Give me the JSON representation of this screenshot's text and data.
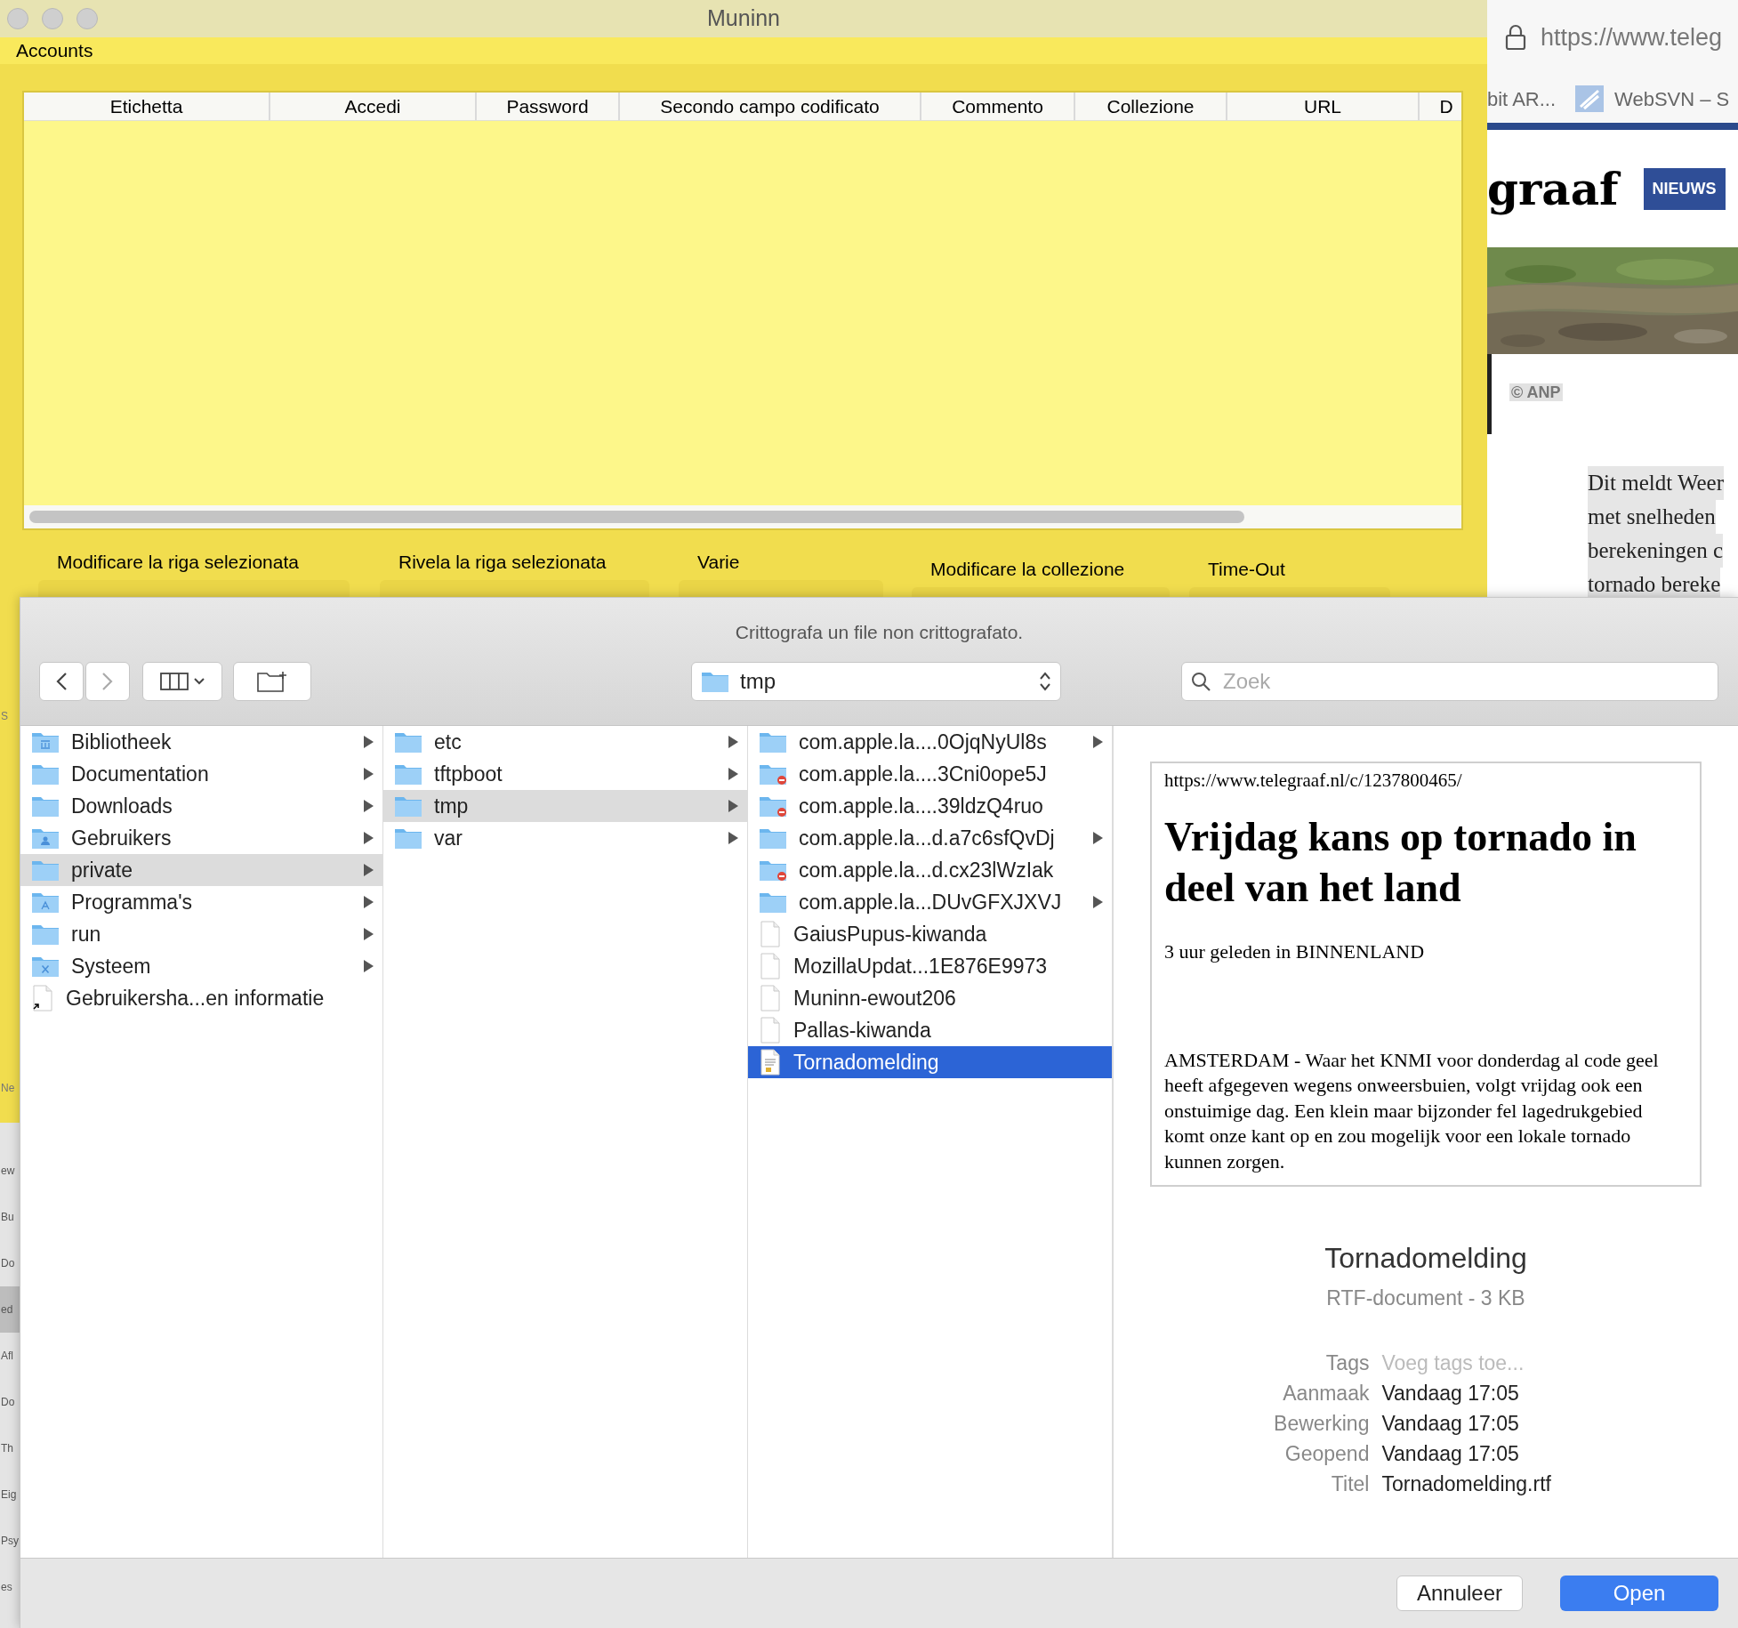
{
  "muninn": {
    "title": "Muninn",
    "menu": "Accounts",
    "table": {
      "columns": [
        "Etichetta",
        "Accedi",
        "Password",
        "Secondo campo codificato",
        "Commento",
        "Collezione",
        "URL",
        "D"
      ]
    },
    "buttons": [
      "Modificare la riga selezionata",
      "Rivela la riga selezionata",
      "Varie",
      "Modificare la collezione",
      "Time-Out"
    ],
    "edge_fragments": [
      "S",
      "Ne"
    ]
  },
  "finder_strip": {
    "items": [
      {
        "label": "ew",
        "selected": false
      },
      {
        "label": "Bu",
        "selected": false
      },
      {
        "label": "Do",
        "selected": false
      },
      {
        "label": "ed",
        "selected": true
      },
      {
        "label": "Afl",
        "selected": false
      },
      {
        "label": "Do",
        "selected": false
      },
      {
        "label": "Th",
        "selected": false
      },
      {
        "label": "Eig",
        "selected": false
      },
      {
        "label": "Psy",
        "selected": false
      },
      {
        "label": "es",
        "selected": false
      }
    ]
  },
  "browser": {
    "address": "https://www.teleg",
    "bookmarks": [
      {
        "label": "bit AR...",
        "icon": false
      },
      {
        "label": "WebSVN – S",
        "icon": true
      }
    ],
    "logo": "graaf",
    "section_badge": "NIEUWS",
    "credit": "© ANP",
    "article_lines": [
      "Dit meldt Weer",
      "met snelheden",
      "berekeningen c",
      "tornado bereke"
    ]
  },
  "dialog": {
    "title": "Crittografa un file non crittografato.",
    "toolbar": {
      "path": "tmp",
      "search_placeholder": "Zoek"
    },
    "columns": [
      {
        "focused": false,
        "items": [
          {
            "name": "Bibliotheek",
            "kind": "library",
            "has_children": true,
            "restricted": false,
            "selected": false
          },
          {
            "name": "Documentation",
            "kind": "folder",
            "has_children": true,
            "restricted": false,
            "selected": false
          },
          {
            "name": "Downloads",
            "kind": "folder",
            "has_children": true,
            "restricted": false,
            "selected": false
          },
          {
            "name": "Gebruikers",
            "kind": "users",
            "has_children": true,
            "restricted": false,
            "selected": false
          },
          {
            "name": "private",
            "kind": "folder",
            "has_children": true,
            "restricted": false,
            "selected": true
          },
          {
            "name": "Programma's",
            "kind": "apps",
            "has_children": true,
            "restricted": false,
            "selected": false
          },
          {
            "name": "run",
            "kind": "folder",
            "has_children": true,
            "restricted": false,
            "selected": false
          },
          {
            "name": "Systeem",
            "kind": "system",
            "has_children": true,
            "restricted": false,
            "selected": false
          },
          {
            "name": "Gebruikersha...en informatie",
            "kind": "alias",
            "has_children": false,
            "restricted": false,
            "selected": false
          }
        ]
      },
      {
        "focused": false,
        "items": [
          {
            "name": "etc",
            "kind": "folder",
            "has_children": true,
            "restricted": false,
            "selected": false
          },
          {
            "name": "tftpboot",
            "kind": "folder",
            "has_children": true,
            "restricted": false,
            "selected": false
          },
          {
            "name": "tmp",
            "kind": "folder",
            "has_children": true,
            "restricted": false,
            "selected": true
          },
          {
            "name": "var",
            "kind": "folder",
            "has_children": true,
            "restricted": false,
            "selected": false
          }
        ]
      },
      {
        "focused": true,
        "items": [
          {
            "name": "com.apple.la....0OjqNyUl8s",
            "kind": "folder",
            "has_children": true,
            "restricted": false,
            "selected": false
          },
          {
            "name": "com.apple.la....3Cni0ope5J",
            "kind": "folder",
            "has_children": false,
            "restricted": true,
            "selected": false
          },
          {
            "name": "com.apple.la....39ldzQ4ruo",
            "kind": "folder",
            "has_children": false,
            "restricted": true,
            "selected": false
          },
          {
            "name": "com.apple.la...d.a7c6sfQvDj",
            "kind": "folder",
            "has_children": true,
            "restricted": false,
            "selected": false
          },
          {
            "name": "com.apple.la...d.cx23lWzIak",
            "kind": "folder",
            "has_children": false,
            "restricted": true,
            "selected": false
          },
          {
            "name": "com.apple.la...DUvGFXJXVJ",
            "kind": "folder",
            "has_children": true,
            "restricted": false,
            "selected": false
          },
          {
            "name": "GaiusPupus-kiwanda",
            "kind": "file",
            "has_children": false,
            "restricted": false,
            "selected": false
          },
          {
            "name": "MozillaUpdat...1E876E9973",
            "kind": "file",
            "has_children": false,
            "restricted": false,
            "selected": false
          },
          {
            "name": "Muninn-ewout206",
            "kind": "file",
            "has_children": false,
            "restricted": false,
            "selected": false
          },
          {
            "name": "Pallas-kiwanda",
            "kind": "file",
            "has_children": false,
            "restricted": false,
            "selected": false
          },
          {
            "name": "Tornadomelding",
            "kind": "rtf",
            "has_children": false,
            "restricted": false,
            "selected": true
          }
        ]
      }
    ],
    "preview": {
      "document": {
        "url": "https://www.telegraaf.nl/c/1237800465/",
        "heading": "Vrijdag kans op tornado in deel van het land",
        "meta": "3 uur geleden in BINNENLAND",
        "body": "AMSTERDAM - Waar het KNMI voor donderdag al code geel heeft afgegeven wegens onweersbuien, volgt vrijdag ook een onstuimige dag. Een klein maar bijzonder fel lagedrukgebied komt onze kant op en zou mogelijk voor een lokale tornado kunnen zorgen."
      },
      "name": "Tornadomelding",
      "type": "RTF-document - 3 KB",
      "info": [
        {
          "label": "Tags",
          "placeholder": "Voeg tags toe..."
        },
        {
          "label": "Aanmaak",
          "value": "Vandaag 17:05"
        },
        {
          "label": "Bewerking",
          "value": "Vandaag 17:05"
        },
        {
          "label": "Geopend",
          "value": "Vandaag 17:05"
        },
        {
          "label": "Titel",
          "value": "Tornadomelding.rtf"
        }
      ]
    },
    "buttons": [
      {
        "label": "Annuleer",
        "default": false
      },
      {
        "label": "Open",
        "default": true
      }
    ]
  }
}
